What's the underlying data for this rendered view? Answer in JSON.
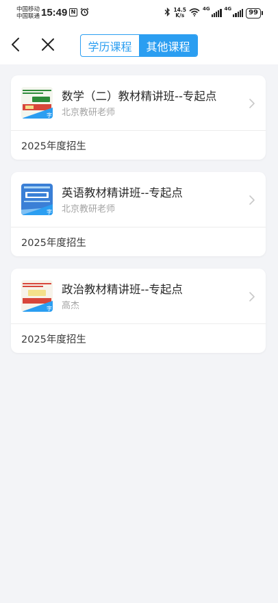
{
  "status_bar": {
    "carrier_line1": "中国移动",
    "carrier_line2": "中国联通",
    "time": "15:49",
    "nfc_label": "N",
    "speed_value": "14.5",
    "speed_unit": "K/s",
    "net1": "4G",
    "net2": "4G",
    "battery": "99"
  },
  "nav": {
    "tabs": [
      {
        "label": "学历课程",
        "active": false
      },
      {
        "label": "其他课程",
        "active": true
      }
    ]
  },
  "courses": [
    {
      "title": "数学（二）教材精讲班--专起点",
      "teacher": "北京教研老师",
      "footer": "2025年度招生",
      "thumb_color": "#2e8b3a"
    },
    {
      "title": "英语教材精讲班--专起点",
      "teacher": "北京教研老师",
      "footer": "2025年度招生",
      "thumb_color": "#3a7fd6"
    },
    {
      "title": "政治教材精讲班--专起点",
      "teacher": "高杰",
      "footer": "2025年度招生",
      "thumb_color": "#d8463a"
    }
  ]
}
